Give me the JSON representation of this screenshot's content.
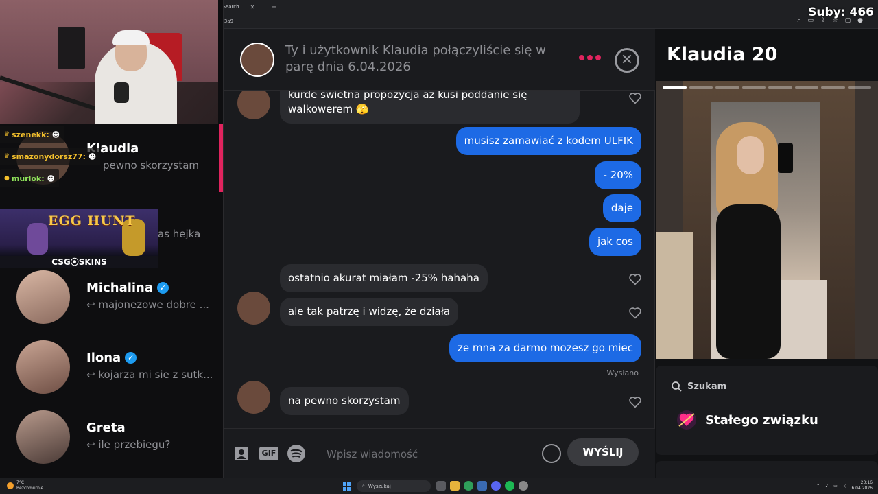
{
  "browser": {
    "tab_label": "e Search",
    "tab_close": "✕",
    "new_tab": "+",
    "url_fragment": "3d3a9"
  },
  "stream_overlay": {
    "subs_label": "Suby: 466",
    "chat": [
      {
        "user": "szenekk:",
        "color": "#f4c02c"
      },
      {
        "user": "smazonydorsz77:",
        "color": "#f4c02c"
      },
      {
        "user": "murlok:",
        "color": "#8ee05a"
      }
    ],
    "banner_title": "EGG HUNT",
    "banner_brand": "CSG⦿SKINS"
  },
  "conversations": [
    {
      "name": "Klaudia",
      "preview": "pewno skorzystam",
      "verified": false,
      "active": true
    },
    {
      "name": "",
      "preview": "as hejka",
      "verified": false,
      "active": false
    },
    {
      "name": "Michalina",
      "preview": "↩ majonezowe dobre ...",
      "verified": true,
      "active": false
    },
    {
      "name": "Ilona",
      "preview": "↩ kojarza mi sie z sutk...",
      "verified": true,
      "active": false
    },
    {
      "name": "Greta",
      "preview": "↩ ile przebiegu?",
      "verified": false,
      "active": false
    }
  ],
  "chat_header": {
    "match_text": "Ty i użytkownik Klaudia połączyliście się w parę dnia 6.04.2026",
    "accent": "#e0245e"
  },
  "messages": [
    {
      "dir": "in",
      "text": "kurde swietna propozycja az kusi poddanie się walkowerem 🫣"
    },
    {
      "dir": "out",
      "text": "musisz zamawiać z kodem ULFIK"
    },
    {
      "dir": "out",
      "text": "- 20%"
    },
    {
      "dir": "out",
      "text": "daje"
    },
    {
      "dir": "out",
      "text": "jak cos"
    },
    {
      "dir": "in",
      "text": "ostatnio akurat miałam -25% hahaha"
    },
    {
      "dir": "in",
      "text": "ale tak patrzę i widzę, że działa"
    },
    {
      "dir": "out",
      "text": "ze mna za darmo mozesz go miec"
    },
    {
      "dir": "in",
      "text": "na pewno skorzystam"
    }
  ],
  "sent_label": "Wysłano",
  "composer": {
    "gif_label": "GIF",
    "placeholder": "Wpisz wiadomość",
    "send_label": "WYŚLIJ"
  },
  "profile": {
    "name_age": "Klaudia 20",
    "looking_label": "Szukam",
    "relationship": "Stałego związku",
    "photo_count": 8,
    "photo_active_index": 0
  },
  "taskbar": {
    "temp": "7°C",
    "weather": "Bezchmurnie",
    "search_placeholder": "Wyszukaj",
    "time": "23:16",
    "date": "6.04.2026"
  },
  "colors": {
    "accent_pink": "#e0245e",
    "outgoing_blue": "#1d6ae5",
    "incoming_gray": "#2a2b2f",
    "verified_blue": "#1d9bf0"
  }
}
